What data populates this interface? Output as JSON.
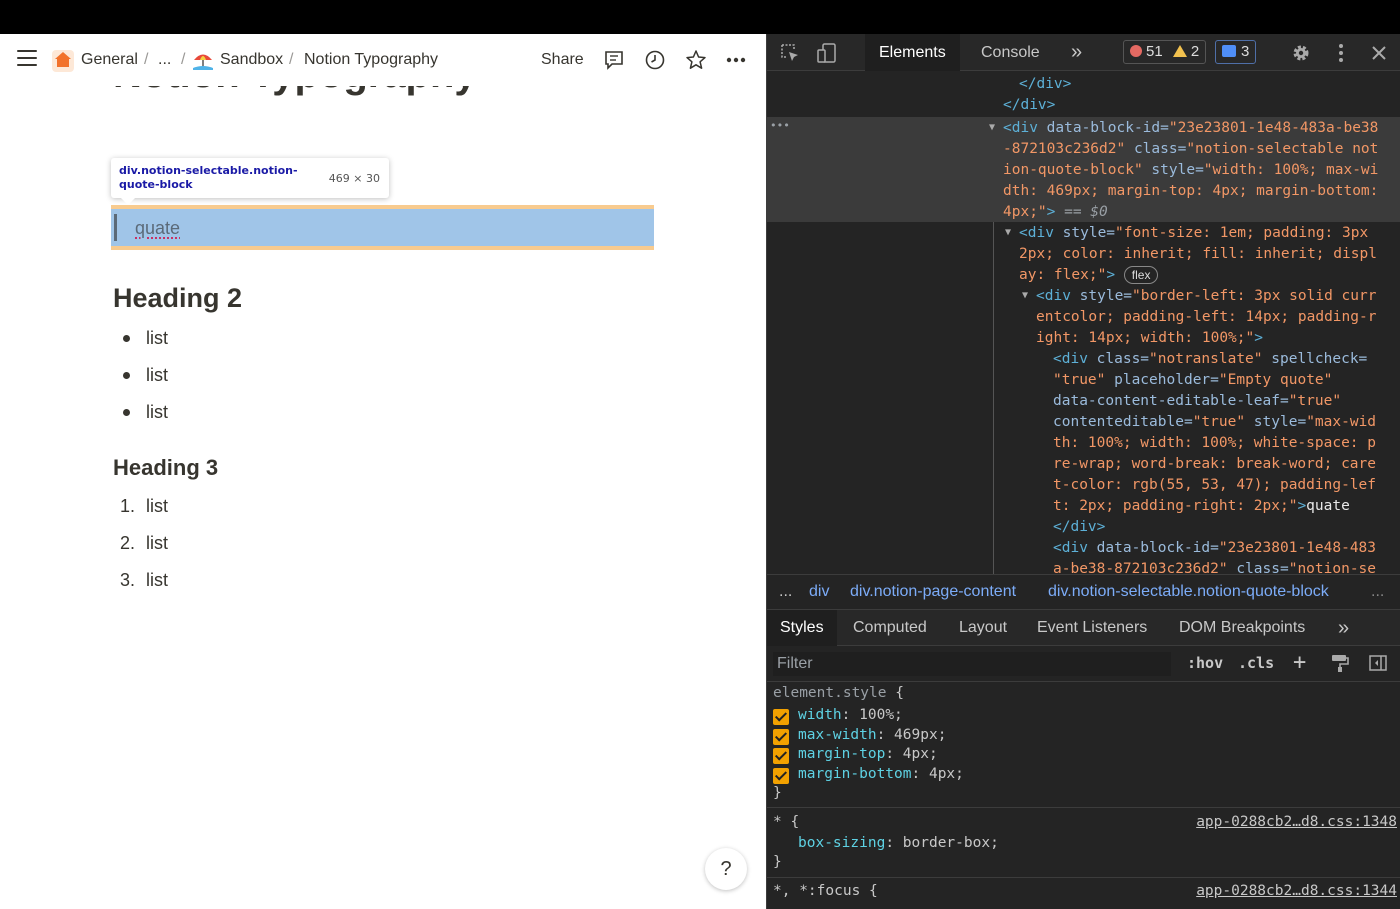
{
  "notion": {
    "breadcrumb": {
      "general": "General",
      "sep1": "/",
      "ellipsis": "...",
      "sep2": "/",
      "sandbox": "Sandbox",
      "sep3": "/",
      "page": "Notion Typography"
    },
    "share_label": "Share",
    "title": "Notion Typography",
    "tooltip": {
      "selector": "div.notion-selectable.notion-quote-block",
      "dims": "469 × 30"
    },
    "quote_text": "quate",
    "heading2": "Heading 2",
    "bullets": [
      "list",
      "list",
      "list"
    ],
    "heading3": "Heading 3",
    "numbered": [
      {
        "n": "1.",
        "text": "list"
      },
      {
        "n": "2.",
        "text": "list"
      },
      {
        "n": "3.",
        "text": "list"
      }
    ],
    "help_label": "?"
  },
  "devtools": {
    "tabs": [
      "Elements",
      "Console",
      "»"
    ],
    "errors": "51",
    "warnings": "2",
    "messages": "3",
    "breadcrumbs": [
      "...",
      "div",
      "div.notion-page-content",
      "div.notion-selectable.notion-quote-block",
      "..."
    ],
    "subtabs": [
      "Styles",
      "Computed",
      "Layout",
      "Event Listeners",
      "DOM Breakpoints",
      "»"
    ],
    "filter_placeholder": "Filter",
    "hov": ":hov",
    "cls": ".cls",
    "plus": "+",
    "element_style": {
      "selector": "element.style",
      "open": "{",
      "close": "}",
      "props": [
        {
          "name": "width",
          "value": "100%;"
        },
        {
          "name": "max-width",
          "value": "469px;"
        },
        {
          "name": "margin-top",
          "value": "4px;"
        },
        {
          "name": "margin-bottom",
          "value": "4px;"
        }
      ]
    },
    "rule1": {
      "selector": "* {",
      "prop": "box-sizing",
      "value": "border-box;",
      "close": "}",
      "source": "app-0288cb2…d8.css:1348"
    },
    "rule2": {
      "selector": "*, *:focus {",
      "source": "app-0288cb2…d8.css:1344"
    },
    "dom": {
      "l1": "</div>",
      "l2": "</div>",
      "dots": "•••",
      "sel_tag_open": "<div",
      "sel_a1": " data-block-id=",
      "sel_v1": "\"23e23801-1e48-483a-be38",
      "sel_v1b": "-872103c236d2\"",
      "sel_a2": " class=",
      "sel_v2": "\"notion-selectable not",
      "sel_v2b": "ion-quote-block\"",
      "sel_a3": " style=",
      "sel_v3": "\"width: 100%; max-wi",
      "sel_v3b": "dth: 469px; margin-top: 4px; margin-bottom:",
      "sel_v3c": "4px;\"",
      "sel_tag_close": ">",
      "sel_eq": " == $0",
      "c1_tag": "<div",
      "c1_a": " style=",
      "c1_v1": "\"font-size: 1em; padding: 3px",
      "c1_v2": "2px; color: inherit; fill: inherit; displ",
      "c1_v3": "ay: flex;\"",
      "c1_close": ">",
      "flex": "flex",
      "c2_tag": "<div",
      "c2_a": " style=",
      "c2_v1": "\"border-left: 3px solid curr",
      "c2_v2": "entcolor; padding-left: 14px; padding-r",
      "c2_v3": "ight: 14px; width: 100%;\"",
      "c2_close": ">",
      "c3_tag": "<div",
      "c3_a1": " class=",
      "c3_v1": "\"notranslate\"",
      "c3_a2": " spellcheck=",
      "c3_v2": "\"true\"",
      "c3_a3": " placeholder=",
      "c3_v3": "\"Empty quote\"",
      "c3_a4": "data-content-editable-leaf=",
      "c3_v4": "\"true\"",
      "c3_a5": "contenteditable=",
      "c3_v5": "\"true\"",
      "c3_a6": " style=",
      "c3_v6": "\"max-wid",
      "c3_v6b": "th: 100%; width: 100%; white-space: p",
      "c3_v6c": "re-wrap; word-break: break-word; care",
      "c3_v6d": "t-color: rgb(55, 53, 47); padding-lef",
      "c3_v6e": "t: 2px; padding-right: 2px;\"",
      "c3_close": ">",
      "c3_text": "quate",
      "c3_end": "</div>",
      "c4_tag": "<div",
      "c4_a": " data-block-id=",
      "c4_v": "\"23e23801-1e48-483",
      "c4_vb": "a-be38-872103c236d2\"",
      "c4_a2": " class=",
      "c4_v2": "\"notion-se"
    }
  }
}
